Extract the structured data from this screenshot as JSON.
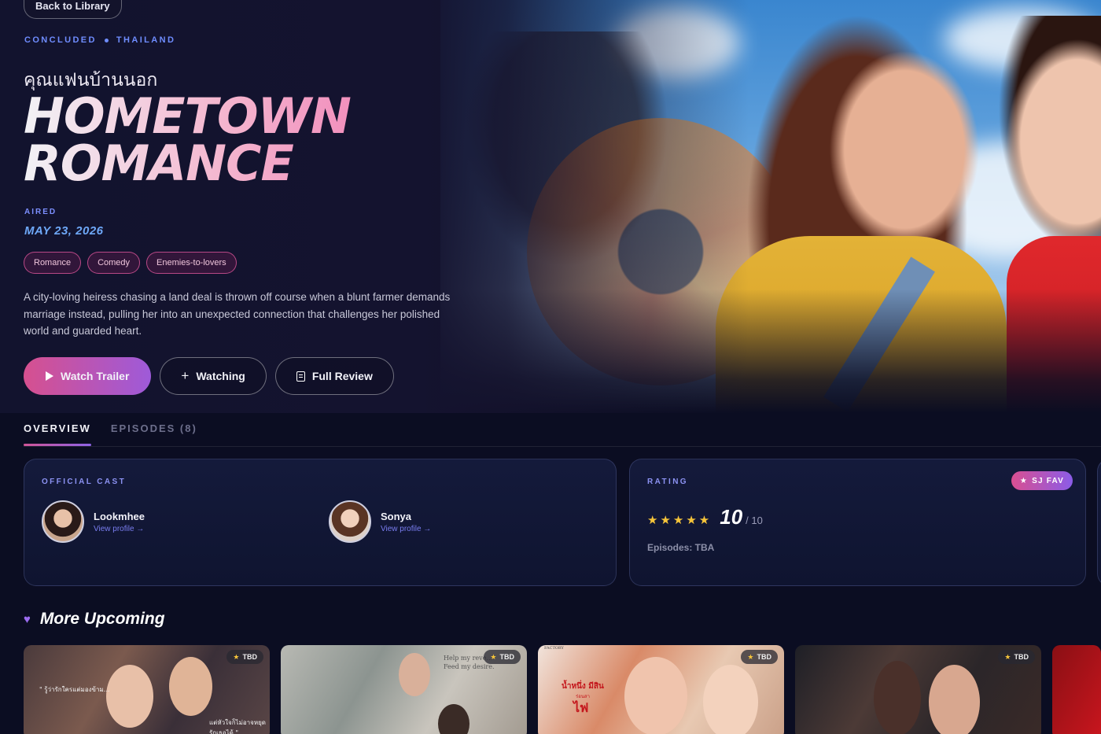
{
  "nav": {
    "back_label": "Back to Library"
  },
  "show": {
    "status": "CONCLUDED",
    "country": "THAILAND",
    "thai_title": "คุณแฟนบ้านนอก",
    "title_line1": "HOMETOWN",
    "title_line2": "ROMANCE",
    "aired_label": "AIRED",
    "aired_date": "MAY 23, 2026",
    "tags": [
      "Romance",
      "Comedy",
      "Enemies-to-lovers"
    ],
    "synopsis": "A city-loving heiress chasing a land deal is thrown off course when a blunt farmer demands marriage instead, pulling her into an unexpected connection that challenges her polished world and guarded heart."
  },
  "actions": {
    "watch_trailer": "Watch Trailer",
    "watching": "Watching",
    "full_review": "Full Review"
  },
  "tabs": [
    {
      "label": "OVERVIEW",
      "active": true
    },
    {
      "label": "EPISODES (8)",
      "active": false
    }
  ],
  "cast_card": {
    "label": "OFFICIAL CAST",
    "members": [
      {
        "name": "Lookmhee",
        "link": "View profile →"
      },
      {
        "name": "Sonya",
        "link": "View profile →"
      }
    ]
  },
  "rating_card": {
    "label": "RATING",
    "badge": "SJ FAV",
    "stars": 5,
    "score": "10",
    "score_max": "/ 10",
    "episodes": "Episodes: TBA"
  },
  "upcoming": {
    "title": "More Upcoming",
    "badge": "TBD",
    "posters": [
      {
        "texts": [
          "\" รู้ว่ารักใครแต่มองข้าม...",
          "แต่หัวใจก็ไม่อาจหยุดรักเธอได้ \""
        ]
      },
      {
        "texts": [
          "Help my reve...",
          "Feed my desire."
        ]
      },
      {
        "texts": [
          "FACTORY",
          "น้ำหนึ่ง มีสิน",
          "ร่อนสา",
          "ไฟ"
        ]
      },
      {
        "texts": []
      },
      {
        "texts": []
      }
    ]
  },
  "colors": {
    "accent_pink": "#d6508f",
    "accent_purple": "#9e5ad9",
    "label_blue": "#6f8dff",
    "star_gold": "#f5c43a",
    "background": "#0b0d22"
  }
}
